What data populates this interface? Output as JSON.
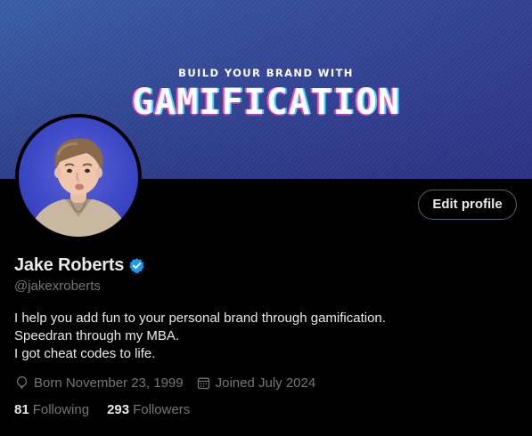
{
  "banner": {
    "tagline": "BUILD YOUR BRAND WITH",
    "headline": "GAMIFICATION"
  },
  "profile": {
    "name": "Jake Roberts",
    "handle": "@jakexroberts",
    "verified": true,
    "edit_label": "Edit profile",
    "bio": [
      "I help you add fun to your personal brand through gamification.",
      "Speedran through my MBA.",
      "I got cheat codes to life."
    ],
    "born": "Born November 23, 1999",
    "joined": "Joined July 2024"
  },
  "stats": {
    "following_count": "81",
    "following_label": "Following",
    "followers_count": "293",
    "followers_label": "Followers"
  },
  "colors": {
    "accent_blue": "#1d9bf0",
    "muted_text": "#71767b",
    "primary_text": "#e7e9ea",
    "background": "#000000"
  },
  "icons": {
    "verified": "verified-badge-icon",
    "born": "balloon-icon",
    "joined": "calendar-icon"
  }
}
